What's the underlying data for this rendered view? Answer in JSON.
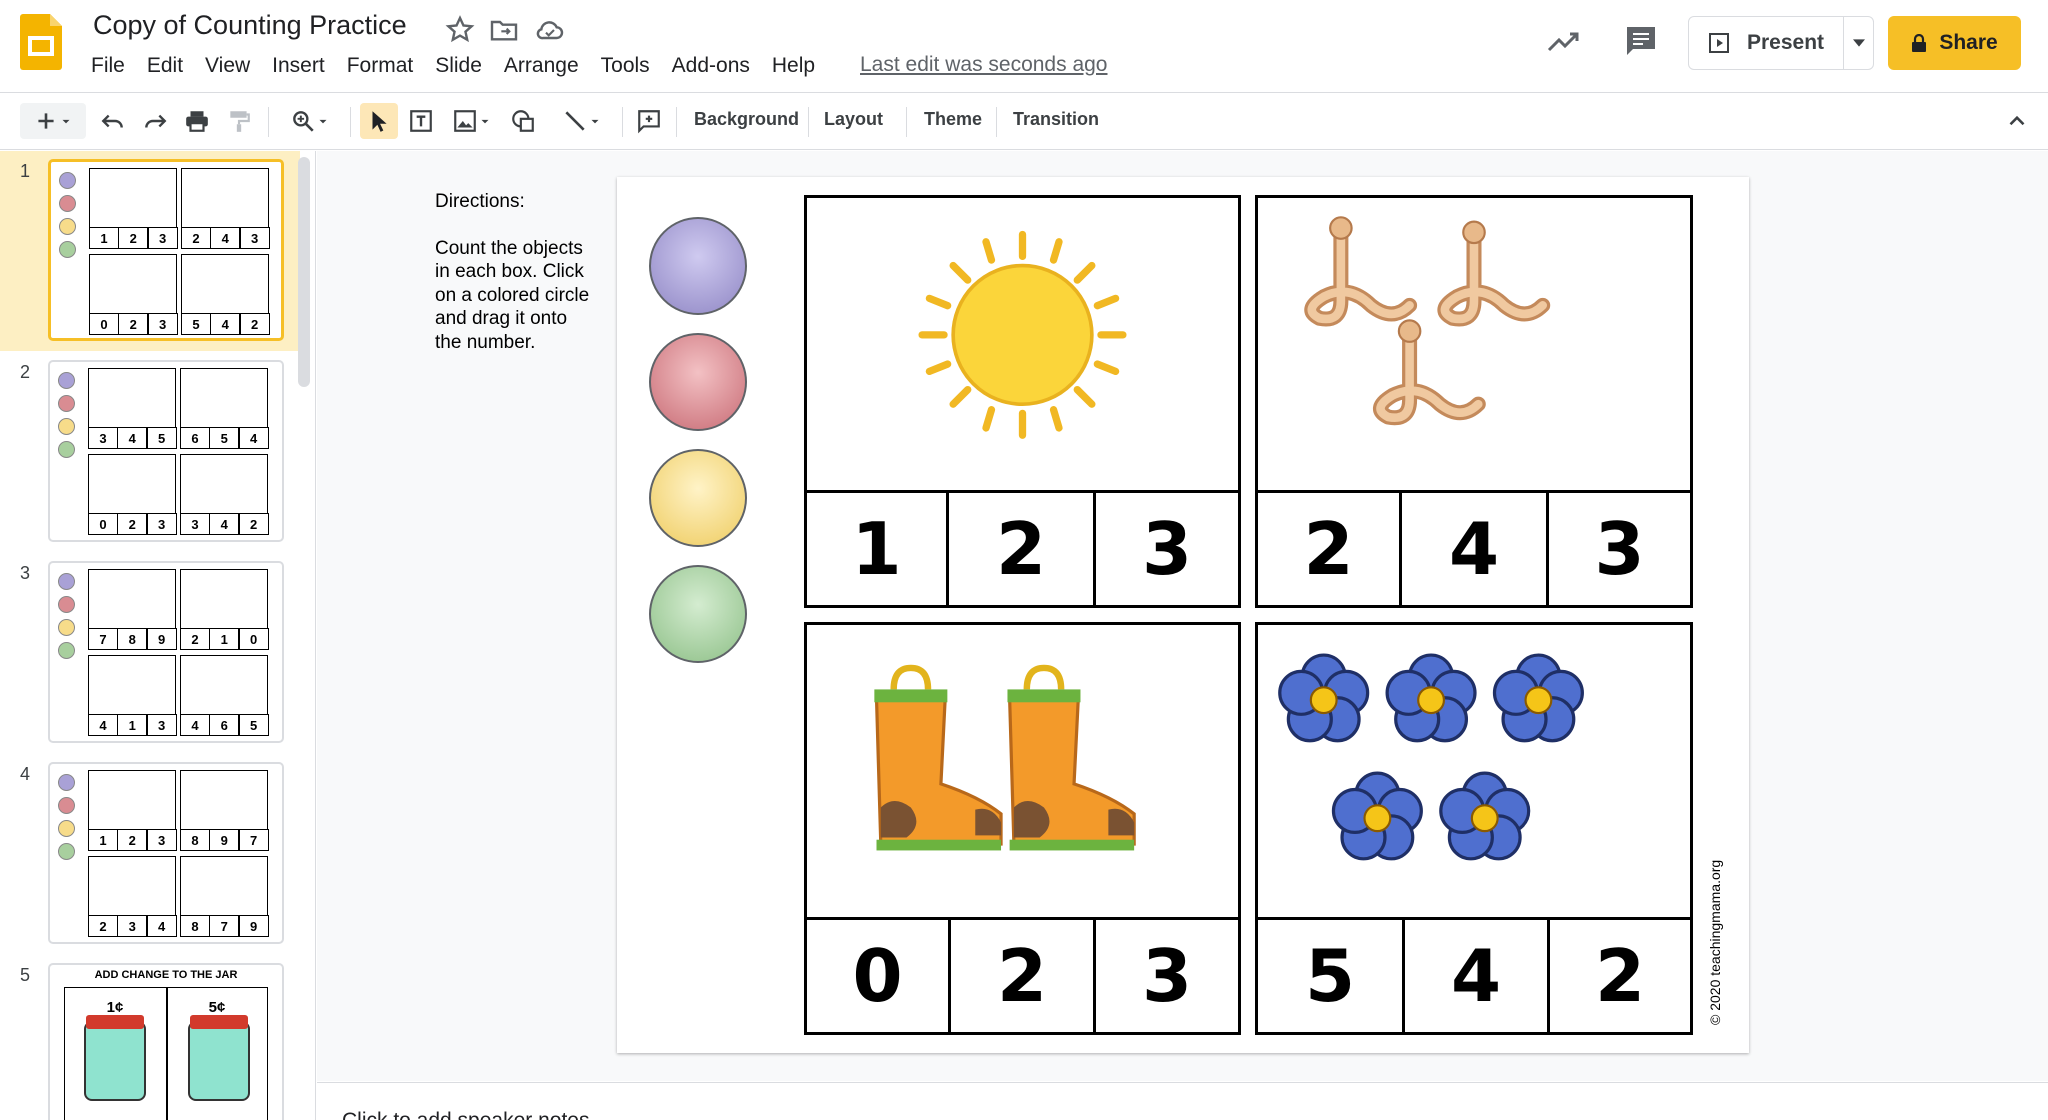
{
  "header": {
    "doc_title": "Copy of Counting Practice",
    "last_edit": "Last edit was seconds ago",
    "present_label": "Present",
    "share_label": "Share"
  },
  "menu": [
    "File",
    "Edit",
    "View",
    "Insert",
    "Format",
    "Slide",
    "Arrange",
    "Tools",
    "Add-ons",
    "Help"
  ],
  "toolbar": {
    "background": "Background",
    "layout": "Layout",
    "theme": "Theme",
    "transition": "Transition"
  },
  "filmstrip": {
    "slides": [
      {
        "num": "1",
        "top_left": [
          "1",
          "2",
          "3"
        ],
        "top_right": [
          "2",
          "4",
          "3"
        ],
        "bottom_left": [
          "0",
          "2",
          "3"
        ],
        "bottom_right": [
          "5",
          "4",
          "2"
        ]
      },
      {
        "num": "2",
        "top_left": [
          "3",
          "4",
          "5"
        ],
        "top_right": [
          "6",
          "5",
          "4"
        ],
        "bottom_left": [
          "0",
          "2",
          "3"
        ],
        "bottom_right": [
          "3",
          "4",
          "2"
        ]
      },
      {
        "num": "3",
        "top_left": [
          "7",
          "8",
          "9"
        ],
        "top_right": [
          "2",
          "1",
          "0"
        ],
        "bottom_left": [
          "4",
          "1",
          "3"
        ],
        "bottom_right": [
          "4",
          "6",
          "5"
        ]
      },
      {
        "num": "4",
        "top_left": [
          "1",
          "2",
          "3"
        ],
        "top_right": [
          "8",
          "9",
          "7"
        ],
        "bottom_left": [
          "2",
          "3",
          "4"
        ],
        "bottom_right": [
          "8",
          "7",
          "9"
        ]
      },
      {
        "num": "5",
        "title": "ADD CHANGE TO THE JAR",
        "jar_left": "1¢",
        "jar_right": "5¢"
      }
    ]
  },
  "slide": {
    "directions_title": "Directions:",
    "directions_body": "Count the objects in each box. Click on a colored circle and drag it onto the number.",
    "box1_numbers": [
      "1",
      "2",
      "3"
    ],
    "box2_numbers": [
      "2",
      "4",
      "3"
    ],
    "box3_numbers": [
      "0",
      "2",
      "3"
    ],
    "box4_numbers": [
      "5",
      "4",
      "2"
    ],
    "credit": "© 2020 teachingmama.org",
    "dot_colors": [
      "#a9a1d6",
      "#d98c92",
      "#f7dc8a",
      "#a8cf9e"
    ]
  },
  "notes": {
    "placeholder": "Click to add speaker notes"
  }
}
